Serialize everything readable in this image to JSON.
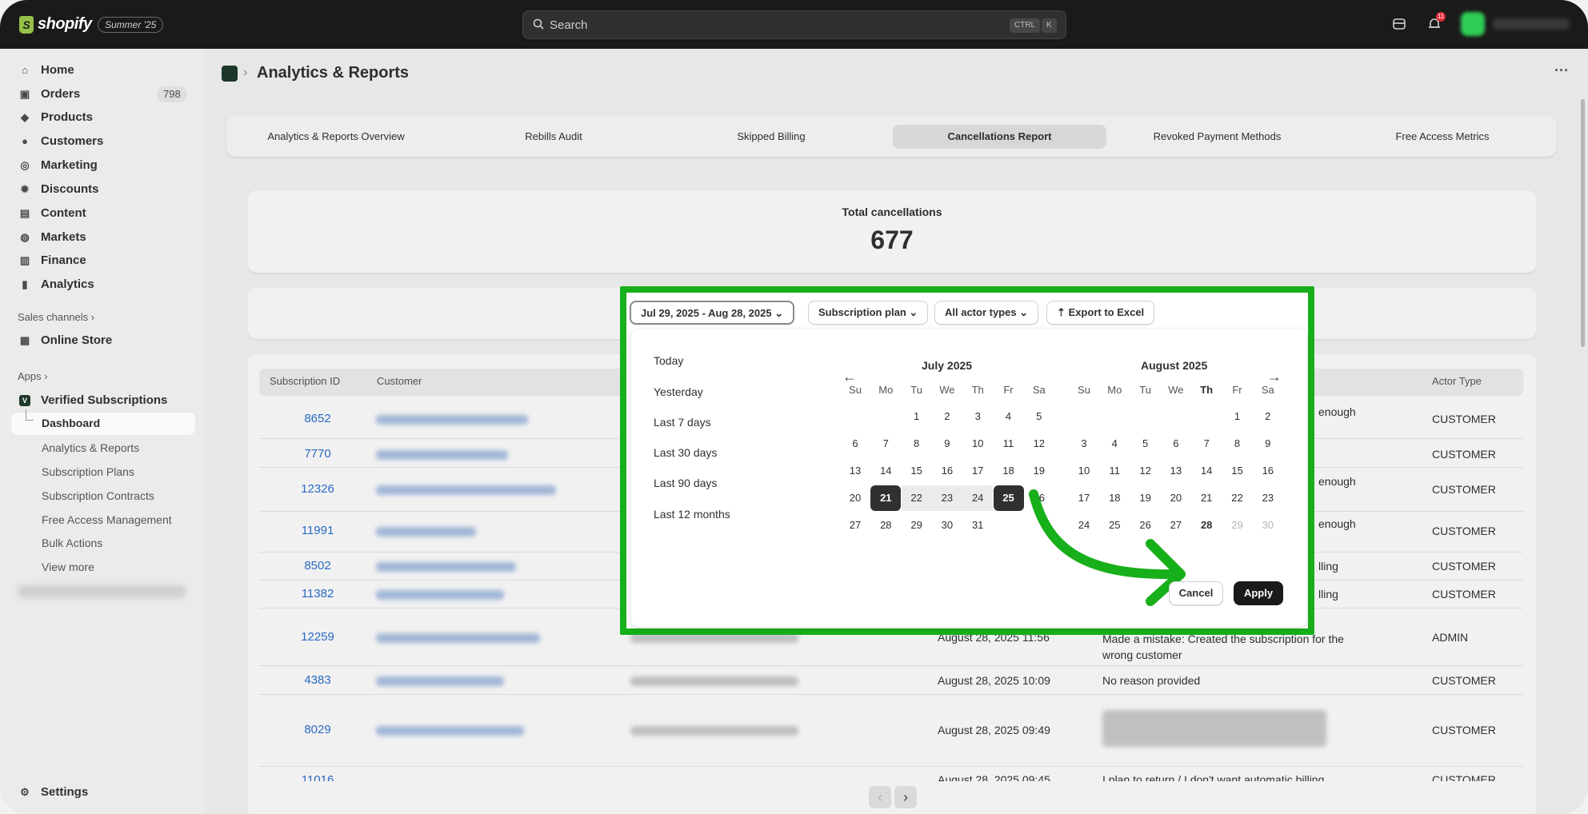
{
  "topbar": {
    "brand": "shopify",
    "edition": "Summer '25",
    "search_placeholder": "Search",
    "kbd_ctrl": "CTRL",
    "kbd_k": "K",
    "notification_count": "11"
  },
  "sidebar": {
    "items": [
      {
        "label": "Home",
        "icon": "home-icon"
      },
      {
        "label": "Orders",
        "icon": "orders-icon",
        "badge": "798"
      },
      {
        "label": "Products",
        "icon": "tag-icon"
      },
      {
        "label": "Customers",
        "icon": "person-icon"
      },
      {
        "label": "Marketing",
        "icon": "target-icon"
      },
      {
        "label": "Discounts",
        "icon": "discount-icon"
      },
      {
        "label": "Content",
        "icon": "content-icon"
      },
      {
        "label": "Markets",
        "icon": "globe-icon"
      },
      {
        "label": "Finance",
        "icon": "bank-icon"
      },
      {
        "label": "Analytics",
        "icon": "bar-chart-icon"
      }
    ],
    "sales_channels_label": "Sales channels",
    "online_store": "Online Store",
    "apps_label": "Apps",
    "app_name": "Verified Subscriptions",
    "app_sub_items": [
      "Dashboard",
      "Analytics & Reports",
      "Subscription Plans",
      "Subscription Contracts",
      "Free Access Management",
      "Bulk Actions",
      "View more"
    ],
    "settings": "Settings"
  },
  "page": {
    "title": "Analytics & Reports",
    "tabs": [
      "Analytics & Reports Overview",
      "Rebills Audit",
      "Skipped Billing",
      "Cancellations Report",
      "Revoked Payment Methods",
      "Free Access Metrics"
    ],
    "active_tab": "Cancellations Report",
    "total_label": "Total cancellations",
    "total_value": "677"
  },
  "filters": {
    "date_range": "Jul 29, 2025 - Aug 28, 2025",
    "plan": "Subscription plan",
    "actor": "All actor types",
    "export": "Export to Excel"
  },
  "datepicker": {
    "presets": [
      "Today",
      "Yesterday",
      "Last 7 days",
      "Last 30 days",
      "Last 90 days",
      "Last 12 months"
    ],
    "weekdays": [
      "Su",
      "Mo",
      "Tu",
      "We",
      "Th",
      "Fr",
      "Sa"
    ],
    "month1": "July 2025",
    "month2": "August 2025",
    "selected_start": "21",
    "selected_end": "25",
    "cancel": "Cancel",
    "apply": "Apply"
  },
  "table": {
    "headers": {
      "id": "Subscription ID",
      "customer": "Customer",
      "actor": "Actor Type"
    },
    "rows": [
      {
        "id": "8652",
        "reason": "enough",
        "actor": "CUSTOMER"
      },
      {
        "id": "7770",
        "reason": "",
        "actor": "CUSTOMER"
      },
      {
        "id": "12326",
        "reason": "enough",
        "actor": "CUSTOMER"
      },
      {
        "id": "11991",
        "reason": "enough",
        "actor": "CUSTOMER"
      },
      {
        "id": "8502",
        "reason": "lling",
        "actor": "CUSTOMER"
      },
      {
        "id": "11382",
        "reason": "lling",
        "actor": "CUSTOMER"
      },
      {
        "id": "12259",
        "date": "August 28, 2025 11:56",
        "reason": "Made a mistake: Created the subscription for the wrong customer",
        "actor": "ADMIN"
      },
      {
        "id": "4383",
        "date": "August 28, 2025 10:09",
        "reason": "No reason provided",
        "actor": "CUSTOMER"
      },
      {
        "id": "8029",
        "date": "August 28, 2025 09:49",
        "reason": "",
        "actor": "CUSTOMER"
      }
    ],
    "cutoff_row": {
      "id": "11016",
      "date": "August 28, 2025 09:45",
      "reason": "I plan to return / I don't want automatic billing",
      "actor": "CUSTOMER"
    }
  },
  "colors": {
    "highlight": "#17b01a",
    "link": "#2c6ecb",
    "dark": "#1a1a1a"
  }
}
